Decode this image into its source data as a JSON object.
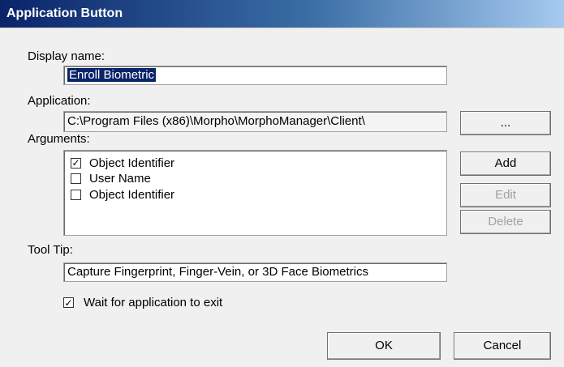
{
  "window": {
    "title": "Application Button"
  },
  "form": {
    "display_name_label": "Display name:",
    "display_name_value": "Enroll Biometric",
    "application_label": "Application:",
    "application_value": "C:\\Program Files (x86)\\Morpho\\MorphoManager\\Client\\",
    "browse_label": "...",
    "arguments_label": "Arguments:",
    "arguments": [
      {
        "label": "Object Identifier",
        "checked": true
      },
      {
        "label": "User Name",
        "checked": false
      },
      {
        "label": "Object Identifier",
        "checked": false
      }
    ],
    "add_label": "Add",
    "edit_label": "Edit",
    "delete_label": "Delete",
    "tooltip_label": "Tool Tip:",
    "tooltip_value": "Capture Fingerprint, Finger-Vein, or 3D Face Biometrics",
    "wait_label": "Wait for application to exit",
    "wait_checked": true
  },
  "footer": {
    "ok_label": "OK",
    "cancel_label": "Cancel"
  }
}
